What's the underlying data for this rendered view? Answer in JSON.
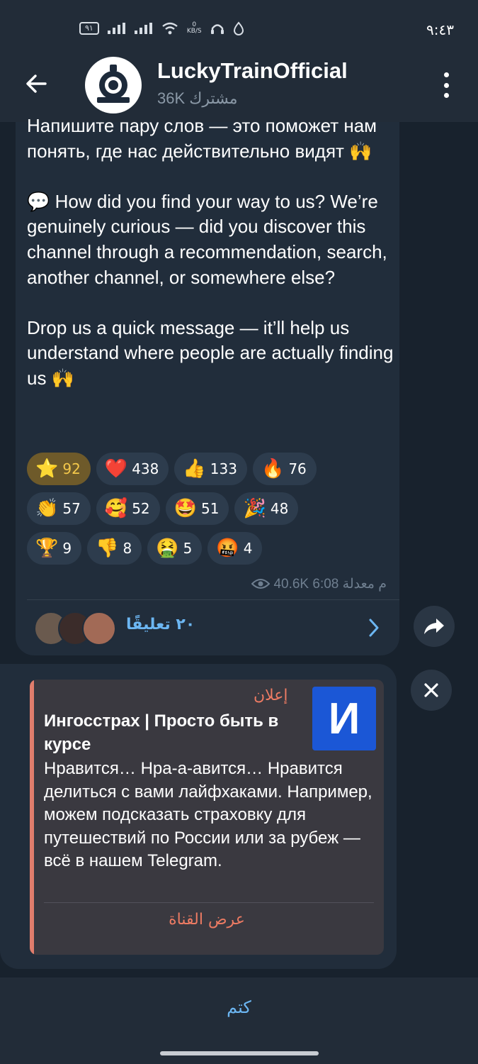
{
  "status_bar": {
    "time": "٩:٤٣",
    "battery": "٩١",
    "speed_unit": "KB/S",
    "speed_value": "0"
  },
  "header": {
    "title": "LuckyTrainOfficial",
    "subscribers": "36K مشترك"
  },
  "message": {
    "paragraphs": [
      "Напишите пару слов — это поможет нам понять, где нас действительно видят 🙌",
      "💬 How did you find your way to us? We’re genuinely curious — did you discover this channel through a recommendation, search, another channel, or somewhere else?",
      "Drop us a quick message — it’ll help us understand where people are actually finding us 🙌"
    ],
    "reactions": [
      {
        "emoji": "⭐",
        "count": "92"
      },
      {
        "emoji": "❤️",
        "count": "438"
      },
      {
        "emoji": "👍",
        "count": "133"
      },
      {
        "emoji": "🔥",
        "count": "76"
      },
      {
        "emoji": "👏",
        "count": "57"
      },
      {
        "emoji": "🥰",
        "count": "52"
      },
      {
        "emoji": "🤩",
        "count": "51"
      },
      {
        "emoji": "🎉",
        "count": "48"
      },
      {
        "emoji": "🏆",
        "count": "9"
      },
      {
        "emoji": "👎",
        "count": "8"
      },
      {
        "emoji": "🤮",
        "count": "5"
      },
      {
        "emoji": "🤬",
        "count": "4"
      }
    ],
    "meta": {
      "views": "40.6K",
      "time": "6:08 م",
      "edited": "معدلة"
    },
    "comments_label": "٢٠ تعليقًا"
  },
  "ad": {
    "label": "إعلان",
    "logo_letter": "И",
    "title": "Ингосстрах | Просто быть в курсе",
    "body": "Нравится… Нра-а-авится… Нравится делиться с вами лайфхаками. Например, можем подсказать страховку для путешествий по России или за рубеж — всё в нашем Telegram.",
    "button": "عرض القناة"
  },
  "bottom": {
    "mute_label": "كتم"
  },
  "colors": {
    "accent": "#6cb6f2",
    "ad_accent": "#ed7b63",
    "bubble": "#212d3b",
    "header": "#222c38"
  }
}
